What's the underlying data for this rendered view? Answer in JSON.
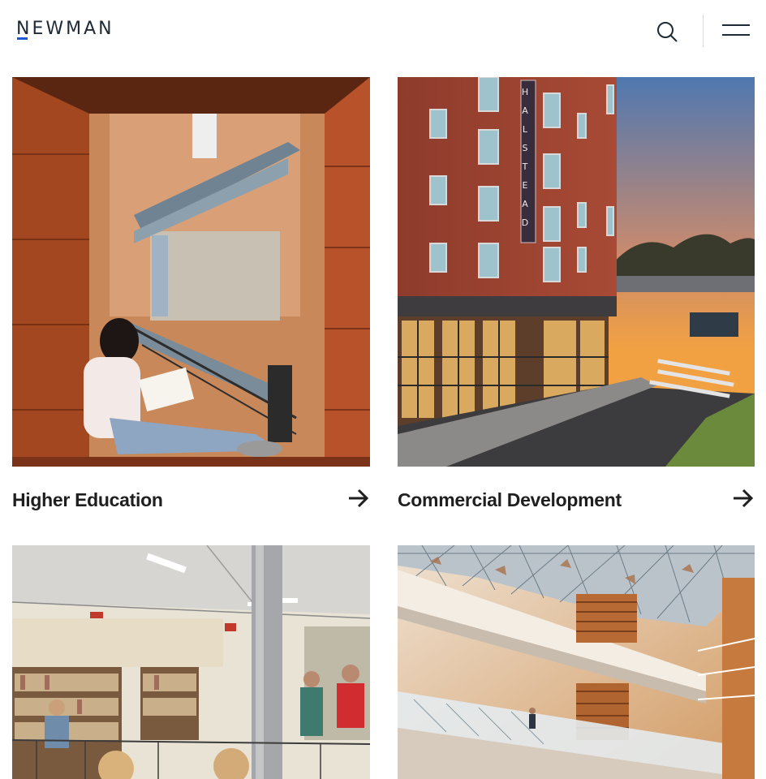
{
  "header": {
    "logo_text": "NEWMAN",
    "accent_color": "#1f57d6",
    "search_icon": "search-icon",
    "menu_icon": "hamburger-menu-icon"
  },
  "cards": [
    {
      "title": "Higher Education",
      "image_subject": "student reading in stairwell",
      "arrow_icon": "arrow-right-icon"
    },
    {
      "title": "Commercial Development",
      "image_subject": "Halstead brick building at sunset",
      "arrow_icon": "arrow-right-icon"
    },
    {
      "title": "",
      "image_subject": "library with students",
      "arrow_icon": "arrow-right-icon"
    },
    {
      "title": "",
      "image_subject": "atrium with glass canopy",
      "arrow_icon": "arrow-right-icon"
    }
  ],
  "sign_text": "HALSTEAD"
}
